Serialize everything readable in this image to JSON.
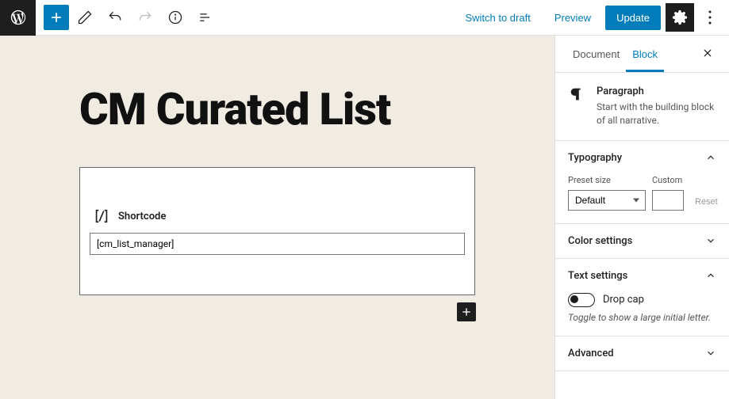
{
  "toolbar": {
    "switch_to_draft": "Switch to draft",
    "preview": "Preview",
    "update": "Update"
  },
  "editor": {
    "page_title": "CM Curated List",
    "shortcode_label": "Shortcode",
    "shortcode_value": "[cm_list_manager]"
  },
  "sidebar": {
    "tabs": {
      "document": "Document",
      "block": "Block"
    },
    "block_info": {
      "name": "Paragraph",
      "desc": "Start with the building block of all narrative."
    },
    "panels": {
      "typography": {
        "title": "Typography",
        "preset_label": "Preset size",
        "preset_value": "Default",
        "custom_label": "Custom",
        "reset": "Reset"
      },
      "color": {
        "title": "Color settings"
      },
      "text": {
        "title": "Text settings",
        "drop_cap": "Drop cap",
        "hint": "Toggle to show a large initial letter."
      },
      "advanced": {
        "title": "Advanced"
      }
    }
  }
}
